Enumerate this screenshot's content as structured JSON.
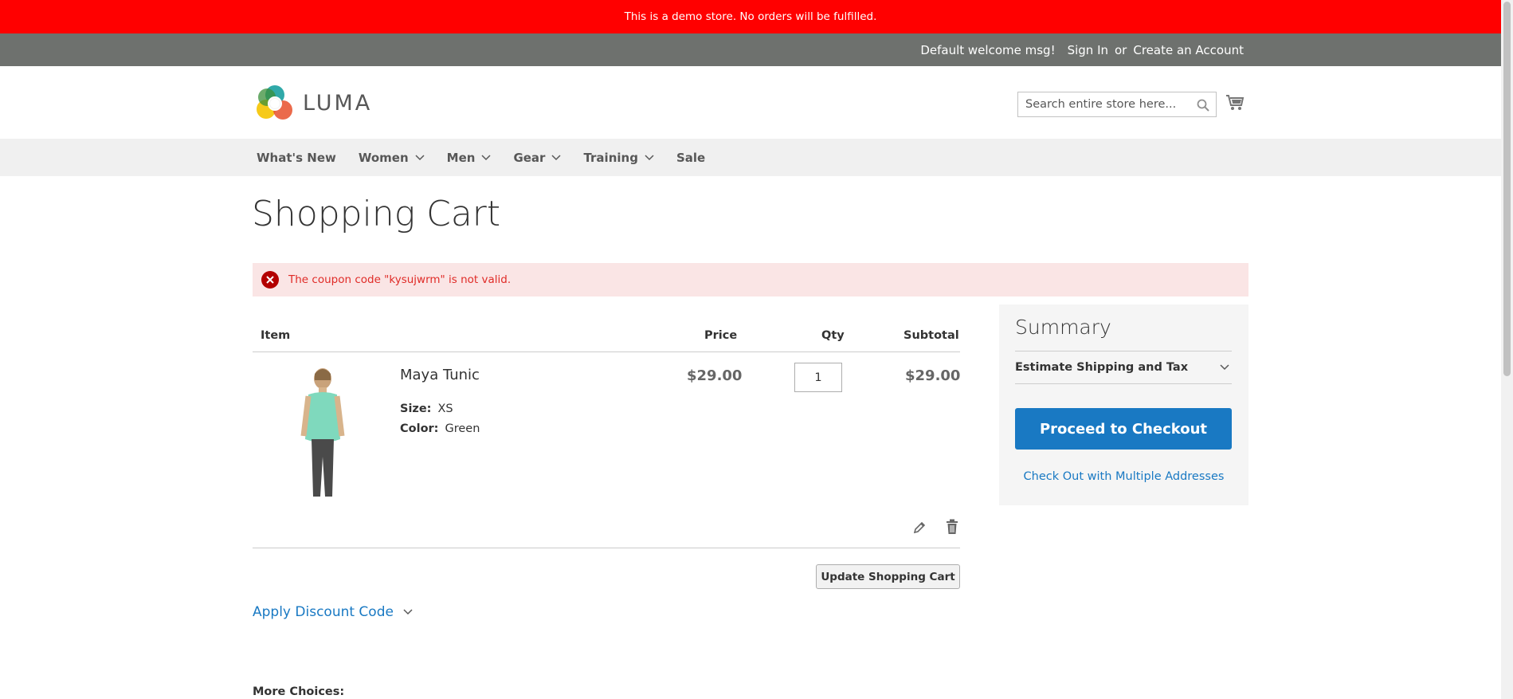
{
  "demo_notice": "This is a demo store. No orders will be fulfilled.",
  "header": {
    "welcome": "Default welcome msg!",
    "sign_in": "Sign In",
    "or": "or",
    "create_account": "Create an Account"
  },
  "logo": {
    "text": "LUMA"
  },
  "search": {
    "placeholder": "Search entire store here..."
  },
  "nav": {
    "items": [
      {
        "label": "What's New",
        "has_dropdown": false
      },
      {
        "label": "Women",
        "has_dropdown": true
      },
      {
        "label": "Men",
        "has_dropdown": true
      },
      {
        "label": "Gear",
        "has_dropdown": true
      },
      {
        "label": "Training",
        "has_dropdown": true
      },
      {
        "label": "Sale",
        "has_dropdown": false
      }
    ]
  },
  "page_title": "Shopping Cart",
  "error_message": "The coupon code \"kysujwrm\" is not valid.",
  "cart": {
    "columns": {
      "item": "Item",
      "price": "Price",
      "qty": "Qty",
      "subtotal": "Subtotal"
    },
    "items": [
      {
        "name": "Maya Tunic",
        "options": [
          {
            "label": "Size:",
            "value": "XS"
          },
          {
            "label": "Color:",
            "value": "Green"
          }
        ],
        "price": "$29.00",
        "qty": "1",
        "subtotal": "$29.00"
      }
    ],
    "update_button": "Update Shopping Cart"
  },
  "discount": {
    "label": "Apply Discount Code"
  },
  "more_choices": "More Choices:",
  "summary": {
    "title": "Summary",
    "estimate_label": "Estimate Shipping and Tax",
    "checkout_button": "Proceed to Checkout",
    "multi_address_link": "Check Out with Multiple Addresses"
  },
  "colors": {
    "demo_bar": "#ff0000",
    "header_panel": "#6e716e",
    "nav_bg": "#f0f0f0",
    "error_bg": "#fae5e5",
    "error_text": "#e02b27",
    "primary": "#1979c3",
    "summary_bg": "#f5f5f5"
  }
}
